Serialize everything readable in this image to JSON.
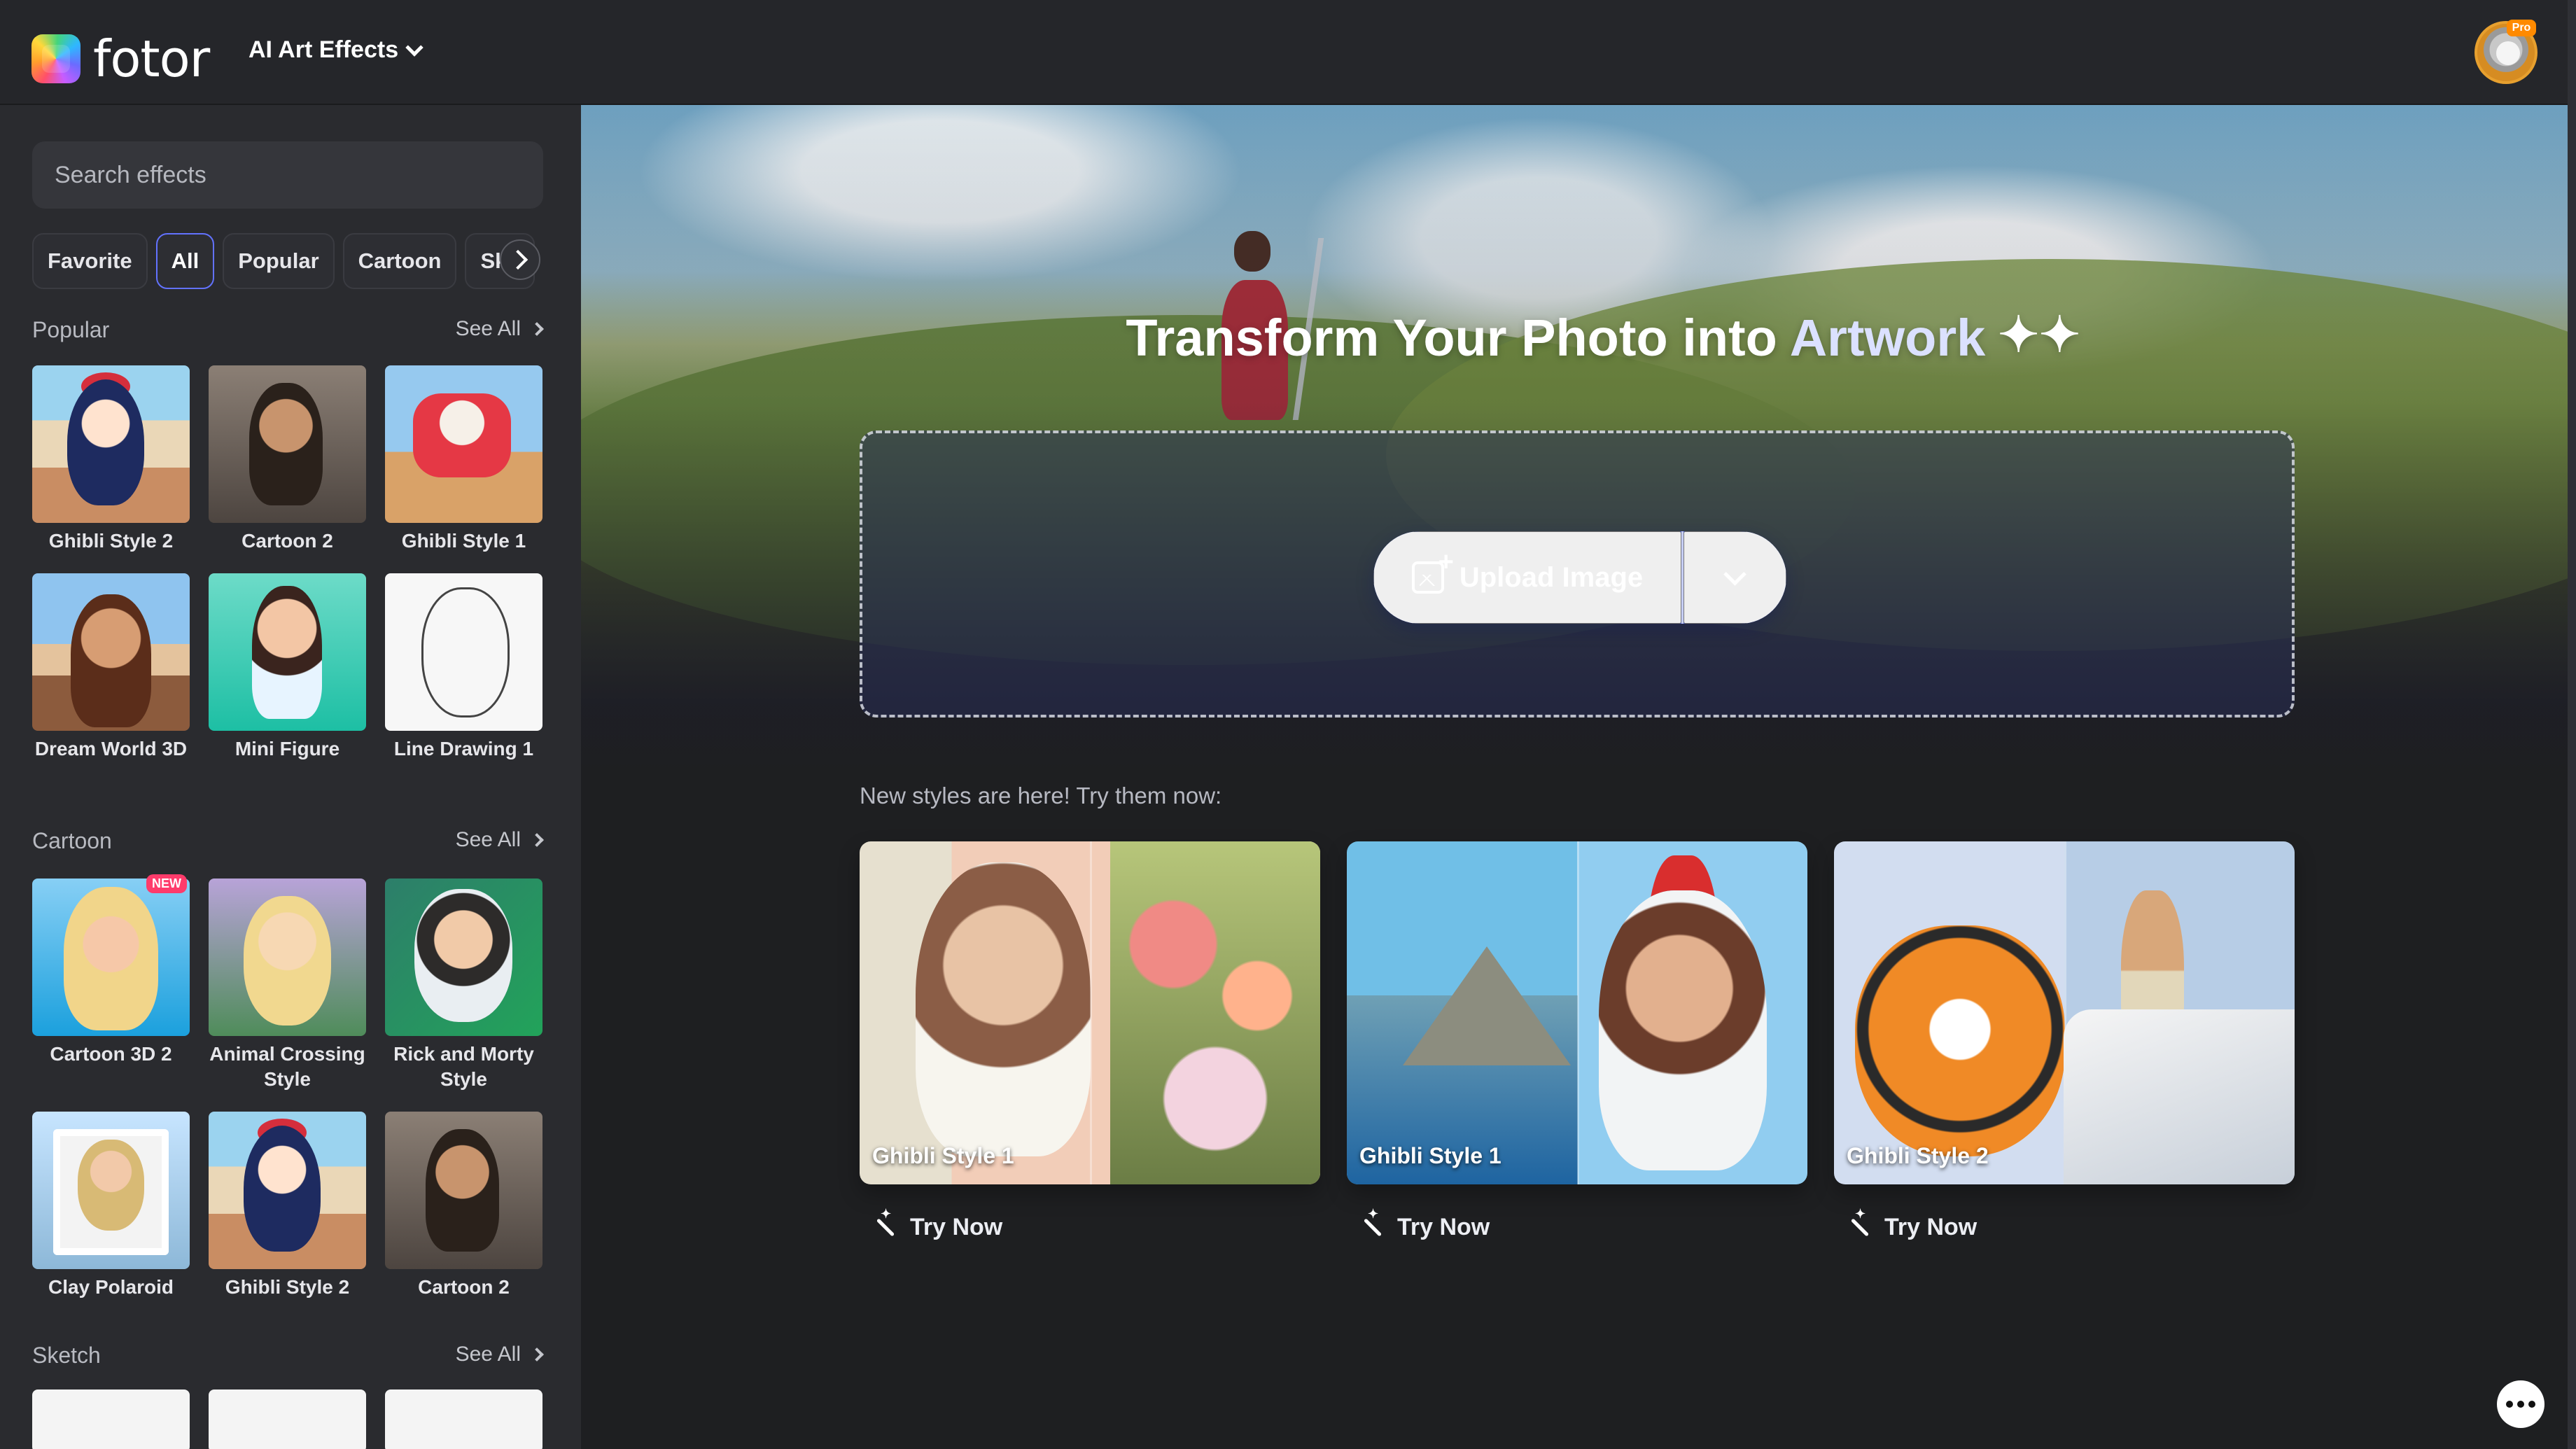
{
  "app": {
    "logo_text": "fotor",
    "menu_label": "AI Art Effects",
    "pro_badge": "Pro"
  },
  "sidebar": {
    "search": {
      "placeholder": "Search effects"
    },
    "chips": [
      "Favorite",
      "All",
      "Popular",
      "Cartoon",
      "Ske"
    ],
    "sections": [
      {
        "title": "Popular",
        "see_all": "See All",
        "items": [
          "Ghibli Style 2",
          "Cartoon 2",
          "Ghibli Style 1",
          "Dream World 3D",
          "Mini Figure",
          "Line Drawing 1"
        ]
      },
      {
        "title": "Cartoon",
        "see_all": "See All",
        "items": [
          "Cartoon 3D 2",
          "Animal Crossing Style",
          "Rick and Morty Style",
          "Clay Polaroid",
          "Ghibli Style 2",
          "Cartoon 2"
        ]
      },
      {
        "title": "Sketch",
        "see_all": "See All",
        "items": [
          "",
          "",
          ""
        ]
      }
    ]
  },
  "hero": {
    "title_part1": "Transform Your Photo into ",
    "title_part2": "Artwork",
    "sparkle": "✦✦",
    "upload_label": "Upload Image"
  },
  "new_styles": {
    "intro": "New styles are here! Try them now:",
    "cards": [
      {
        "label": "Ghibli Style 1",
        "action": "Try Now"
      },
      {
        "label": "Ghibli Style 1",
        "action": "Try Now"
      },
      {
        "label": "Ghibli Style 2",
        "action": "Try Now"
      }
    ],
    "badge_new": "NEW"
  },
  "colors": {
    "accent": "#3f57f0",
    "sidebar_bg": "#2a2b2f",
    "topbar_bg": "#25262a",
    "active_chip_border": "#6272ff"
  },
  "icons": {
    "logo": "fotor-logo-icon",
    "dropdown": "chevron-down-icon",
    "upload": "image-upload-icon",
    "magic": "magic-wand-icon",
    "chat": "more-options-icon"
  }
}
